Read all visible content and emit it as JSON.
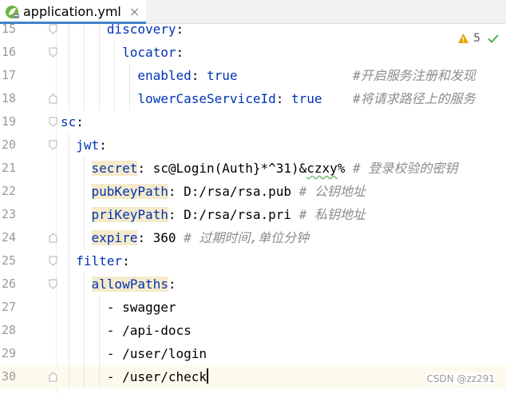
{
  "tab": {
    "filename": "application.yml",
    "close_label": "×",
    "icon": "spring-leaf-icon"
  },
  "inspection": {
    "warning_count": "5",
    "warning_icon": "warning-triangle-icon",
    "ok_icon": "checkmark-icon"
  },
  "colors": {
    "key": "#0033b3",
    "comment": "#8c8c8c",
    "current_line": "#fcfaed",
    "highlight": "#f5eacb",
    "warning": "#e6a400",
    "ok": "#4caf50"
  },
  "lines": [
    {
      "num": "15",
      "indent": "      ",
      "key": "discovery",
      "sep": ":",
      "value": "",
      "comment": ""
    },
    {
      "num": "16",
      "indent": "        ",
      "key": "locator",
      "sep": ":",
      "value": "",
      "comment": ""
    },
    {
      "num": "17",
      "indent": "          ",
      "key": "enabled",
      "sep": ": ",
      "value": "true",
      "pad": "               ",
      "comment": "#开启服务注册和发现"
    },
    {
      "num": "18",
      "indent": "          ",
      "key": "lowerCaseServiceId",
      "sep": ": ",
      "value": "true",
      "pad": "    ",
      "comment": "#将请求路径上的服务"
    },
    {
      "num": "19",
      "indent": "",
      "key": "sc",
      "sep": ":",
      "value": "",
      "comment": ""
    },
    {
      "num": "20",
      "indent": "  ",
      "key": "jwt",
      "sep": ":",
      "value": "",
      "comment": ""
    },
    {
      "num": "21",
      "indent": "    ",
      "key": "secret",
      "sep": ": ",
      "value_pre": "sc@Login(Auth}*^31)&",
      "value_sq": "czxy",
      "value_post": "%",
      "comment": " # 登录校验的密钥"
    },
    {
      "num": "22",
      "indent": "    ",
      "key": "pubKeyPath",
      "sep": ": ",
      "value": "D:/rsa/rsa.pub",
      "comment": " # 公钥地址"
    },
    {
      "num": "23",
      "indent": "    ",
      "key": "priKeyPath",
      "sep": ": ",
      "value": "D:/rsa/rsa.pri",
      "comment": " # 私钥地址"
    },
    {
      "num": "24",
      "indent": "    ",
      "key": "expire",
      "sep": ": ",
      "value": "360",
      "comment": " # 过期时间,单位分钟"
    },
    {
      "num": "25",
      "indent": "  ",
      "key": "filter",
      "sep": ":",
      "value": "",
      "comment": ""
    },
    {
      "num": "26",
      "indent": "    ",
      "key": "allowPaths",
      "sep": ":",
      "value": "",
      "comment": ""
    },
    {
      "num": "27",
      "indent": "      ",
      "item": "- swagger"
    },
    {
      "num": "28",
      "indent": "      ",
      "item": "- /api-docs"
    },
    {
      "num": "29",
      "indent": "      ",
      "item": "- /user/login"
    },
    {
      "num": "30",
      "indent": "      ",
      "item": "- /user/check"
    }
  ],
  "watermark": "CSDN @zz291"
}
